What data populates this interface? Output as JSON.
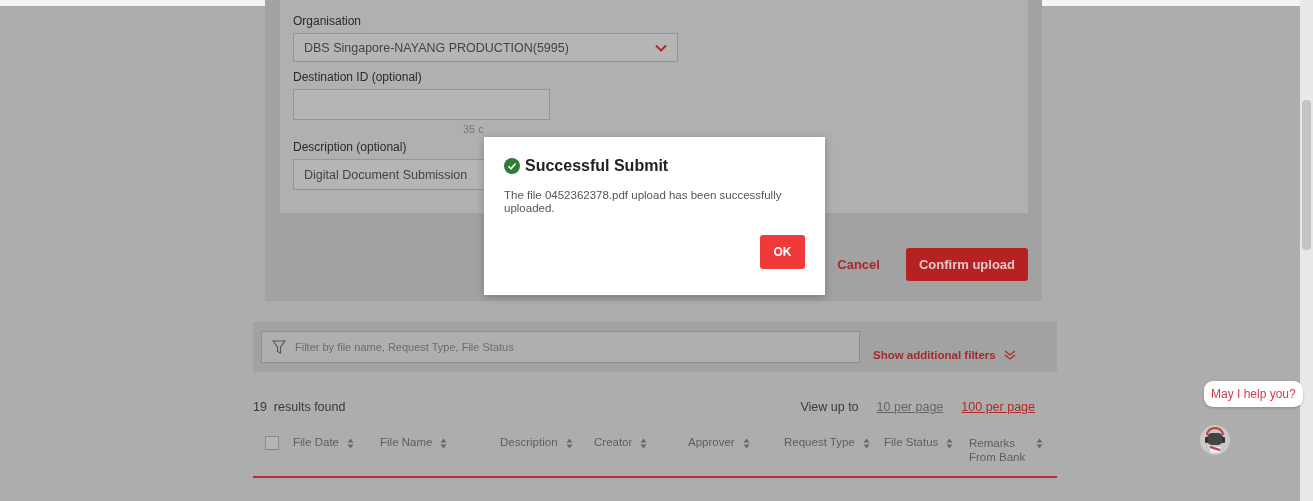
{
  "form": {
    "fields": [
      {
        "kind": "select",
        "label": "Organisation",
        "value": "DBS Singapore-NAYANG PRODUCTION(5995)"
      },
      {
        "kind": "text",
        "label": "Destination ID (optional)",
        "hint": "35 c"
      },
      {
        "kind": "text",
        "label": "Description (optional)",
        "value": "Digital Document Submission"
      }
    ],
    "actions": [
      {
        "kind": "link",
        "label": "Cancel"
      },
      {
        "kind": "primary",
        "label": "Confirm upload"
      }
    ]
  },
  "filter": {
    "placeholder": "Filter by file name, Request Type, File Status",
    "toggle": "Show additional filters"
  },
  "results": {
    "count": "19  results found",
    "view_label": "View up to",
    "page_sizes": [
      {
        "label": "10 per page",
        "selected": false
      },
      {
        "label": "100 per page",
        "selected": true
      }
    ]
  },
  "table": {
    "select_all": {
      "checked": false
    },
    "columns": [
      "File Date",
      "File Name",
      "Description",
      "Creator",
      "Approver",
      "Request Type",
      "File Status",
      "Remarks From Bank"
    ]
  },
  "dialog": {
    "title": "Successful Submit",
    "message": "The file 0452362378.pdf upload has been successfully uploaded.",
    "button": "OK"
  },
  "chat": {
    "bubble": "May I help you?"
  }
}
